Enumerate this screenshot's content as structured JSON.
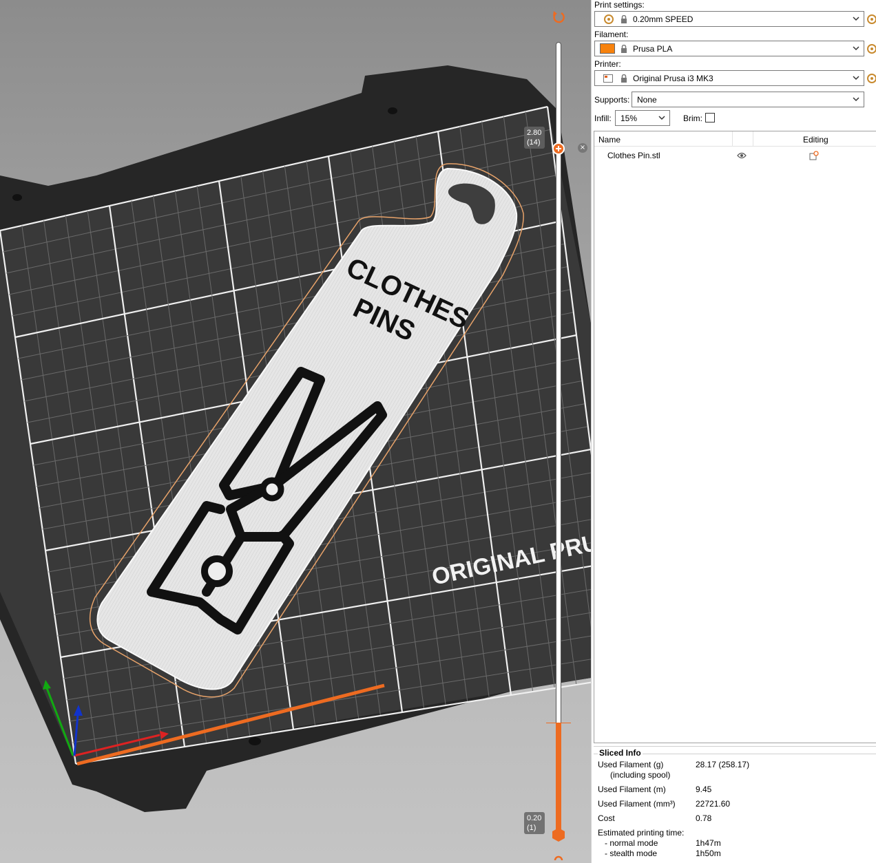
{
  "slider": {
    "top_value": "2.80",
    "top_layer": "(14)",
    "bottom_value": "0.20",
    "bottom_layer": "(1)"
  },
  "bed": {
    "brand_text": "ORIGINAL PRU"
  },
  "model": {
    "text_line1": "CLOTHES",
    "text_line2": "PINS"
  },
  "panel": {
    "print_settings_label": "Print settings:",
    "print_settings_value": "0.20mm SPEED",
    "filament_label": "Filament:",
    "filament_value": "Prusa PLA",
    "filament_color": "#f7820d",
    "printer_label": "Printer:",
    "printer_value": "Original Prusa i3 MK3",
    "supports_label": "Supports:",
    "supports_value": "None",
    "infill_label": "Infill:",
    "infill_value": "15%",
    "brim_label": "Brim:",
    "brim_checked": false
  },
  "object_list": {
    "col_name": "Name",
    "col_editing": "Editing",
    "items": [
      {
        "name": "Clothes Pin.stl"
      }
    ]
  },
  "sliced_info": {
    "title": "Sliced Info",
    "used_filament_g_label": "Used Filament (g)",
    "used_filament_g_sub": "(including spool)",
    "used_filament_g_value": "28.17 (258.17)",
    "used_filament_m_label": "Used Filament (m)",
    "used_filament_m_value": "9.45",
    "used_filament_mm3_label": "Used Filament (mm³)",
    "used_filament_mm3_value": "22721.60",
    "cost_label": "Cost",
    "cost_value": "0.78",
    "print_time_label": "Estimated printing time:",
    "normal_mode_label": "- normal mode",
    "normal_mode_value": "1h47m",
    "stealth_mode_label": "- stealth mode",
    "stealth_mode_value": "1h50m"
  },
  "colors": {
    "accent": "#ed6b21",
    "bed": "#2e2e2e",
    "grid": "#e8e8e8"
  }
}
